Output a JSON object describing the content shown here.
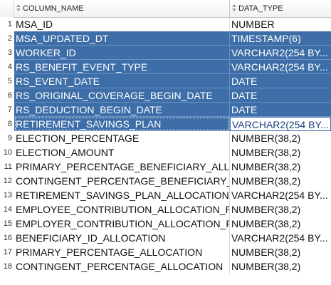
{
  "header": {
    "rownum": "",
    "column_name": "COLUMN_NAME",
    "data_type": "DATA_TYPE"
  },
  "rows": [
    {
      "num": "1",
      "name": "MSA_ID",
      "type": "NUMBER",
      "selected": false
    },
    {
      "num": "2",
      "name": "MSA_UPDATED_DT",
      "type": "TIMESTAMP(6)",
      "selected": true
    },
    {
      "num": "3",
      "name": "WORKER_ID",
      "type": "VARCHAR2(254 BY...",
      "selected": true
    },
    {
      "num": "4",
      "name": "RS_BENEFIT_EVENT_TYPE",
      "type": "VARCHAR2(254 BY...",
      "selected": true
    },
    {
      "num": "5",
      "name": "RS_EVENT_DATE",
      "type": "DATE",
      "selected": true
    },
    {
      "num": "6",
      "name": "RS_ORIGINAL_COVERAGE_BEGIN_DATE",
      "type": "DATE",
      "selected": true
    },
    {
      "num": "7",
      "name": "RS_DEDUCTION_BEGIN_DATE",
      "type": "DATE",
      "selected": true
    },
    {
      "num": "8",
      "name": "RETIREMENT_SAVINGS_PLAN",
      "type": "VARCHAR2(254 BY...",
      "selected": true,
      "focus": true
    },
    {
      "num": "9",
      "name": "ELECTION_PERCENTAGE",
      "type": "NUMBER(38,2)",
      "selected": false
    },
    {
      "num": "10",
      "name": "ELECTION_AMOUNT",
      "type": "NUMBER(38,2)",
      "selected": false
    },
    {
      "num": "11",
      "name": "PRIMARY_PERCENTAGE_BENEFICIARY_ALLO...",
      "type": "NUMBER(38,2)",
      "selected": false
    },
    {
      "num": "12",
      "name": "CONTINGENT_PERCENTAGE_BENEFICIARY_...",
      "type": "NUMBER(38,2)",
      "selected": false
    },
    {
      "num": "13",
      "name": "RETIREMENT_SAVINGS_PLAN_ALLOCATION",
      "type": "VARCHAR2(254 BY...",
      "selected": false
    },
    {
      "num": "14",
      "name": "EMPLOYEE_CONTRIBUTION_ALLOCATION_P...",
      "type": "NUMBER(38,2)",
      "selected": false
    },
    {
      "num": "15",
      "name": "EMPLOYER_CONTRIBUTION_ALLOCATION_P...",
      "type": "NUMBER(38,2)",
      "selected": false
    },
    {
      "num": "16",
      "name": "BENEFICIARY_ID_ALLOCATION",
      "type": "VARCHAR2(254 BY...",
      "selected": false
    },
    {
      "num": "17",
      "name": "PRIMARY_PERCENTAGE_ALLOCATION",
      "type": "NUMBER(38,2)",
      "selected": false
    },
    {
      "num": "18",
      "name": "CONTINGENT_PERCENTAGE_ALLOCATION",
      "type": "NUMBER(38,2)",
      "selected": false
    }
  ],
  "colors": {
    "selection": "#3d6ea8",
    "header_bg": "#f1f1f1"
  },
  "icons": {
    "sort": "sort-arrows-icon"
  }
}
